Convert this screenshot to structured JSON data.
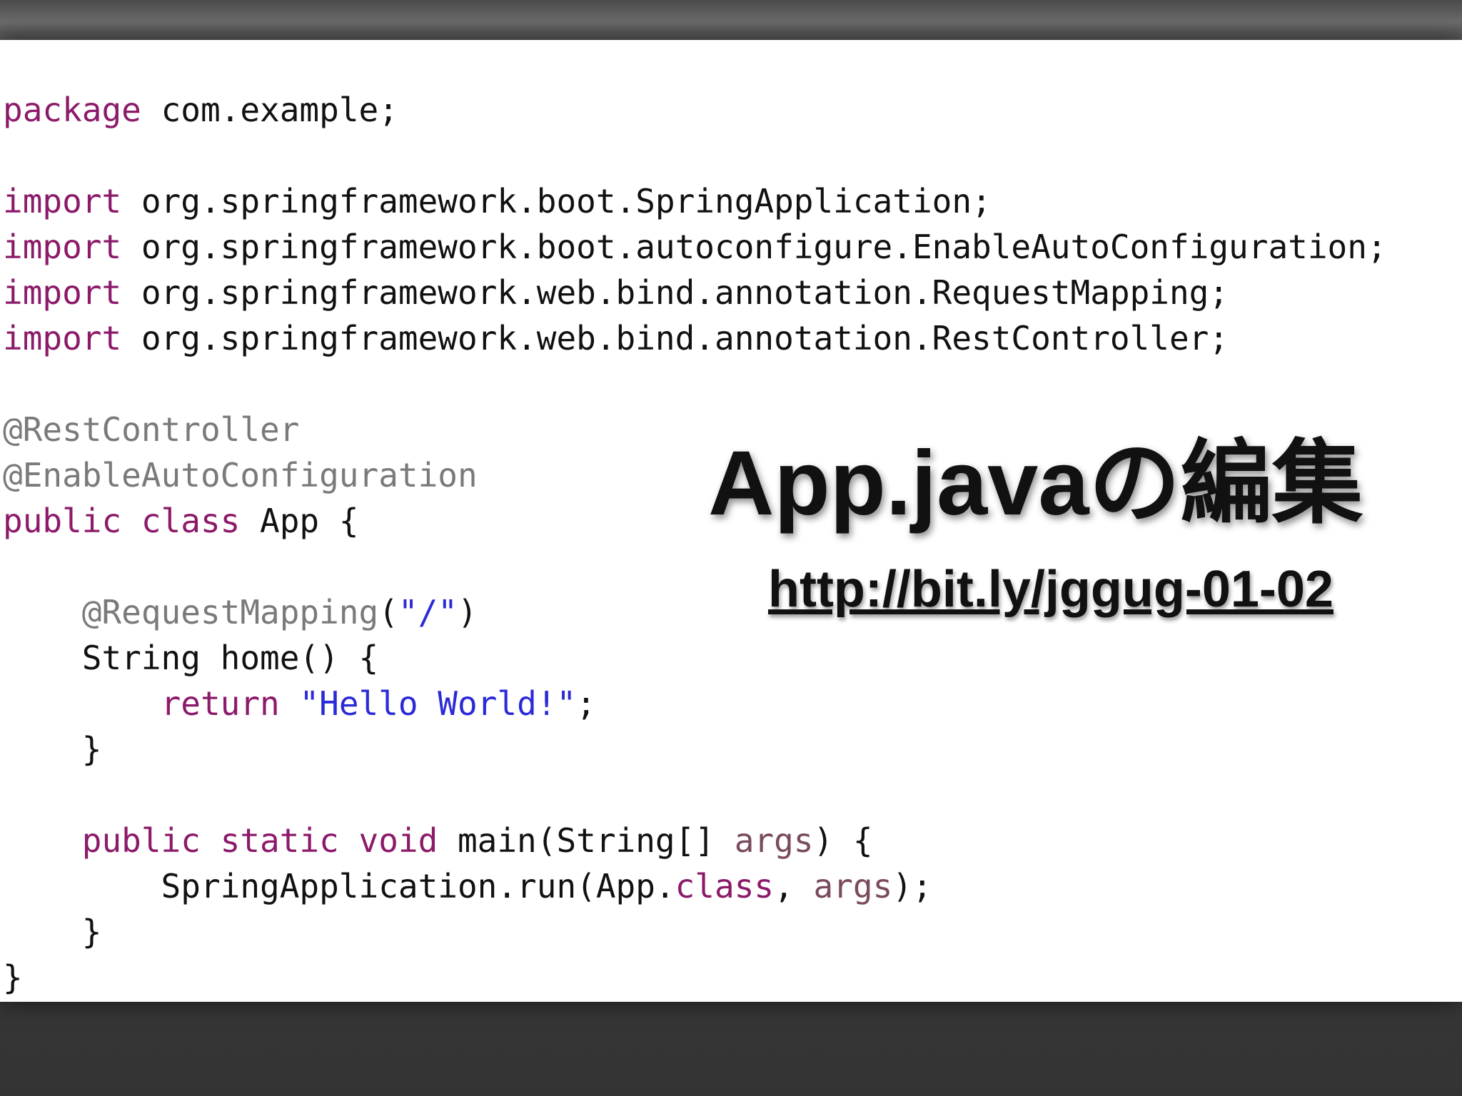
{
  "slide": {
    "title": "App.javaの編集",
    "link": "http://bit.ly/jggug-01-02"
  },
  "code": {
    "l1_kw": "package",
    "l1_rest": " com.example;",
    "l3_kw": "import",
    "l3_rest": " org.springframework.boot.SpringApplication;",
    "l4_kw": "import",
    "l4_rest": " org.springframework.boot.autoconfigure.EnableAutoConfiguration;",
    "l5_kw": "import",
    "l5_rest": " org.springframework.web.bind.annotation.RequestMapping;",
    "l6_kw": "import",
    "l6_rest": " org.springframework.web.bind.annotation.RestController;",
    "l8_ann": "@RestController",
    "l9_ann": "@EnableAutoConfiguration",
    "l10_kw": "public class",
    "l10_rest": " App {",
    "l12_indent": "    ",
    "l12_ann": "@RequestMapping",
    "l12_open": "(",
    "l12_str": "\"/\"",
    "l12_close": ")",
    "l13": "    String home() {",
    "l14_indent": "        ",
    "l14_kw": "return",
    "l14_sp": " ",
    "l14_str": "\"Hello World!\"",
    "l14_end": ";",
    "l15": "    }",
    "l17_indent": "    ",
    "l17_kw": "public static void",
    "l17_mid": " main(String[] ",
    "l17_var": "args",
    "l17_end": ") {",
    "l18_a": "        SpringApplication.run(App.",
    "l18_kw": "class",
    "l18_b": ", ",
    "l18_var": "args",
    "l18_end": ");",
    "l19": "    }",
    "l20": "}"
  },
  "colors": {
    "keyword": "#8c1a6a",
    "annotation": "#7a7a7a",
    "string": "#2a2ad6",
    "variable": "#7a4a5e"
  }
}
